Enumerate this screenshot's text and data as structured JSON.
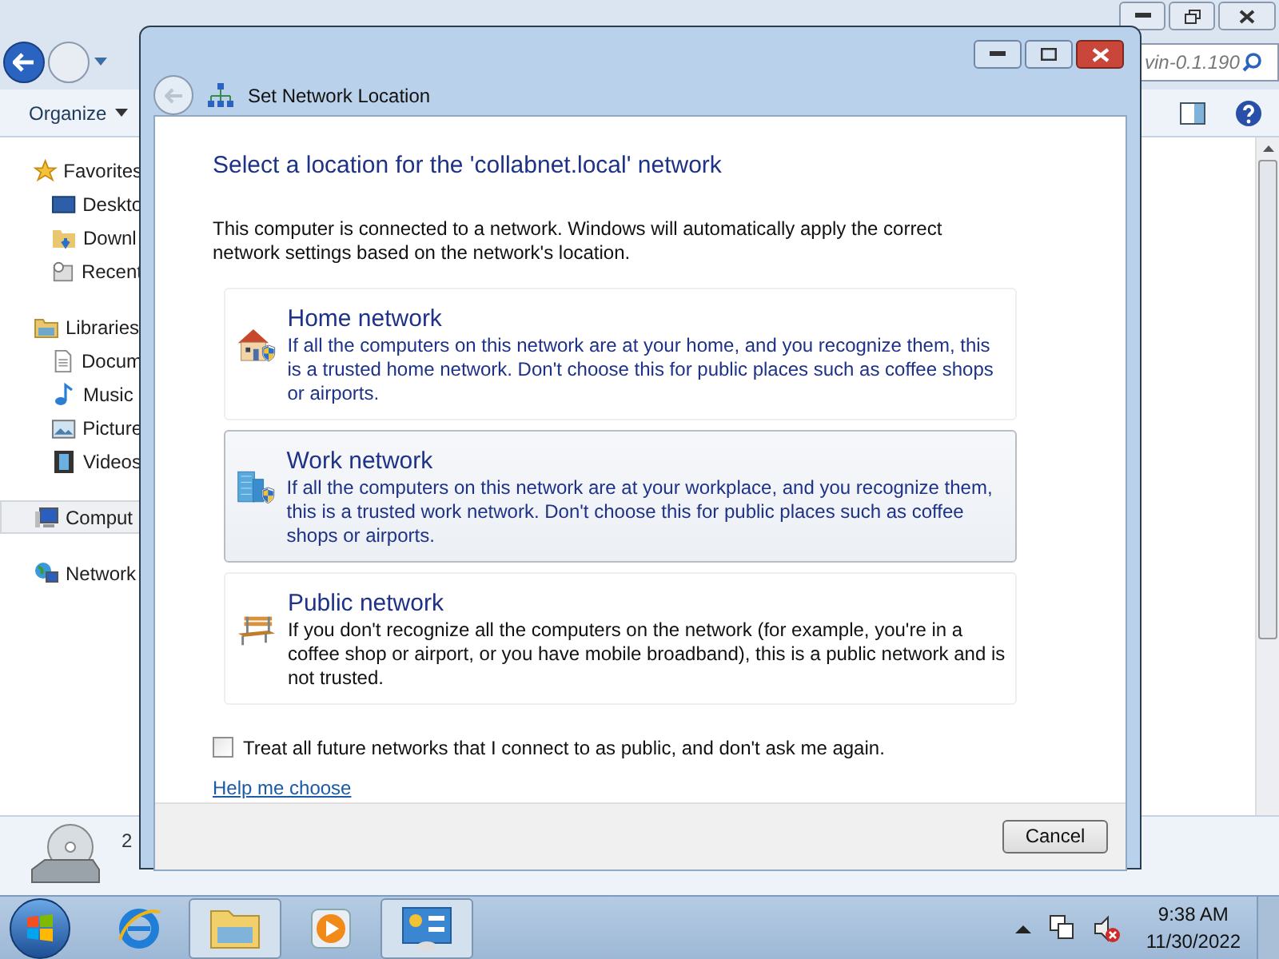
{
  "explorer": {
    "search_text": "vin-0.1.190",
    "organize": "Organize",
    "nav": [
      {
        "kind": "group",
        "label": "Favorites",
        "selected": false
      },
      {
        "kind": "desktop",
        "label": "Deskto",
        "selected": false
      },
      {
        "kind": "downloads",
        "label": "Downl",
        "selected": false
      },
      {
        "kind": "recent",
        "label": "Recent",
        "selected": false
      },
      {
        "kind": "libraries",
        "label": "Libraries",
        "selected": false
      },
      {
        "kind": "documents",
        "label": "Docum",
        "selected": false
      },
      {
        "kind": "music",
        "label": "Music",
        "selected": false
      },
      {
        "kind": "pictures",
        "label": "Picture",
        "selected": false
      },
      {
        "kind": "videos",
        "label": "Videos",
        "selected": false
      },
      {
        "kind": "computer",
        "label": "Comput",
        "selected": true
      },
      {
        "kind": "network",
        "label": "Network",
        "selected": false
      }
    ],
    "details_text": "2"
  },
  "dialog": {
    "title": "Set Network Location",
    "heading": "Select a location for the 'collabnet.local' network",
    "intro": "This computer is connected to a network. Windows will automatically apply the correct network settings based on the network's location.",
    "options": [
      {
        "kind": "home",
        "title": "Home network",
        "description": "If all the computers on this network are at your home, and you recognize them, this is a trusted home network.  Don't choose this for public places such as coffee shops or airports.",
        "selected": false
      },
      {
        "kind": "work",
        "title": "Work network",
        "description": "If all the computers on this network are at your workplace, and you recognize them, this is a trusted work network.  Don't choose this for public places such as coffee shops or airports.",
        "selected": true
      },
      {
        "kind": "public",
        "title": "Public network",
        "description": "If you don't recognize all the computers on the network (for example, you're in a coffee shop or airport, or you have mobile broadband), this is a public network and is not trusted.",
        "selected": false
      }
    ],
    "checkbox": {
      "label": "Treat all future networks that I connect to as public, and don't ask me again.",
      "checked": false
    },
    "help_link": "Help me choose",
    "cancel": "Cancel"
  },
  "taskbar": {
    "apps": [
      {
        "kind": "ie",
        "open": false
      },
      {
        "kind": "explorer",
        "open": true
      },
      {
        "kind": "media",
        "open": false
      },
      {
        "kind": "control",
        "open": true
      }
    ],
    "time": "9:38 AM",
    "date": "11/30/2022"
  }
}
